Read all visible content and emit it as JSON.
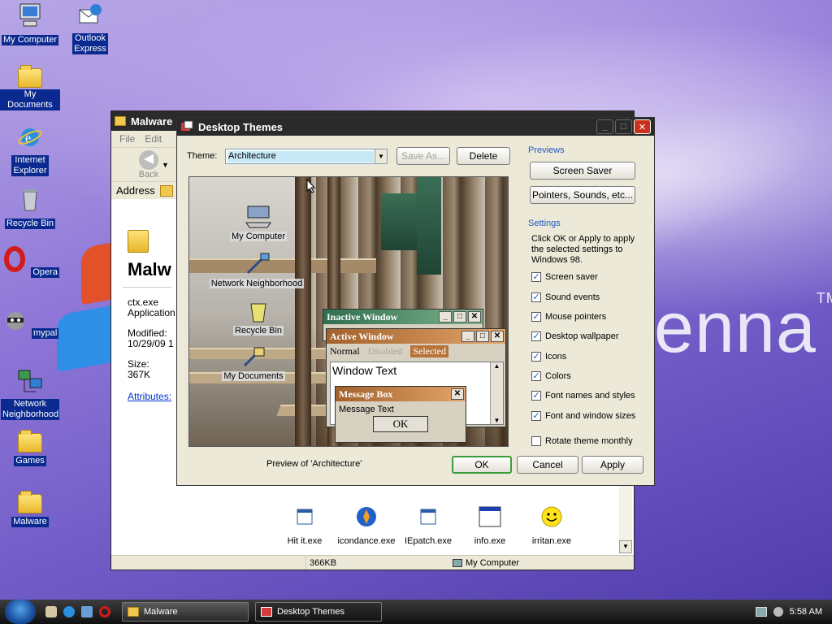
{
  "desktop": {
    "icons": [
      {
        "label": "My Computer"
      },
      {
        "label": "Outlook Express"
      },
      {
        "label": "My Documents"
      },
      {
        "label": "Internet Explorer"
      },
      {
        "label": "Recycle Bin"
      },
      {
        "label": "Opera"
      },
      {
        "label": "mypal"
      },
      {
        "label": "Network Neighborhood"
      },
      {
        "label": "Games"
      },
      {
        "label": "Malware"
      }
    ],
    "brand_text": "enna",
    "brand_tm": "TM"
  },
  "explorer": {
    "title": "Malware",
    "menu": [
      "File",
      "Edit"
    ],
    "back_label": "Back",
    "address_label": "Address",
    "folder_name": "Malw",
    "selected_file": "ctx.exe",
    "file_type": "Application",
    "modified_label": "Modified:",
    "modified_value": "10/29/09 1",
    "size_label": "Size: 367K",
    "attributes_link": "Attributes:",
    "files": [
      {
        "name": "Hit it.exe"
      },
      {
        "name": "icondance.exe"
      },
      {
        "name": "IEpatch.exe"
      },
      {
        "name": "info.exe"
      },
      {
        "name": "irritan.exe"
      }
    ],
    "status_size": "366KB",
    "status_location": "My Computer"
  },
  "dialog": {
    "title": "Desktop Themes",
    "theme_label": "Theme:",
    "theme_value": "Architecture",
    "save_as": "Save As...",
    "delete": "Delete",
    "previews_header": "Previews",
    "screen_saver": "Screen Saver",
    "pointers_sounds": "Pointers, Sounds, etc...",
    "settings_header": "Settings",
    "settings_desc": "Click OK or Apply to apply the selected settings to Windows 98.",
    "settings": [
      {
        "label": "Screen saver",
        "checked": true
      },
      {
        "label": "Sound events",
        "checked": true
      },
      {
        "label": "Mouse pointers",
        "checked": true
      },
      {
        "label": "Desktop wallpaper",
        "checked": true
      },
      {
        "label": "Icons",
        "checked": true
      },
      {
        "label": "Colors",
        "checked": true
      },
      {
        "label": "Font names and styles",
        "checked": true
      },
      {
        "label": "Font and window sizes",
        "checked": true
      },
      {
        "label": "Rotate theme monthly",
        "checked": false
      }
    ],
    "preview_caption": "Preview of 'Architecture'",
    "ok": "OK",
    "cancel": "Cancel",
    "apply": "Apply",
    "preview": {
      "icons": [
        "My Computer",
        "Network Neighborhood",
        "Recycle Bin",
        "My Documents"
      ],
      "inactive_title": "Inactive Window",
      "active_title": "Active Window",
      "menu_normal": "Normal",
      "menu_disabled": "Disabled",
      "menu_selected": "Selected",
      "window_text": "Window Text",
      "msgbox_title": "Message Box",
      "msgbox_text": "Message Text",
      "msgbox_ok": "OK"
    }
  },
  "taskbar": {
    "items": [
      "Malware",
      "Desktop Themes"
    ],
    "clock": "5:58 AM"
  },
  "colors": {
    "accent_blue": "#1f5bbf",
    "active_title": "#b8733a",
    "inactive_title": "#3f7a58"
  }
}
